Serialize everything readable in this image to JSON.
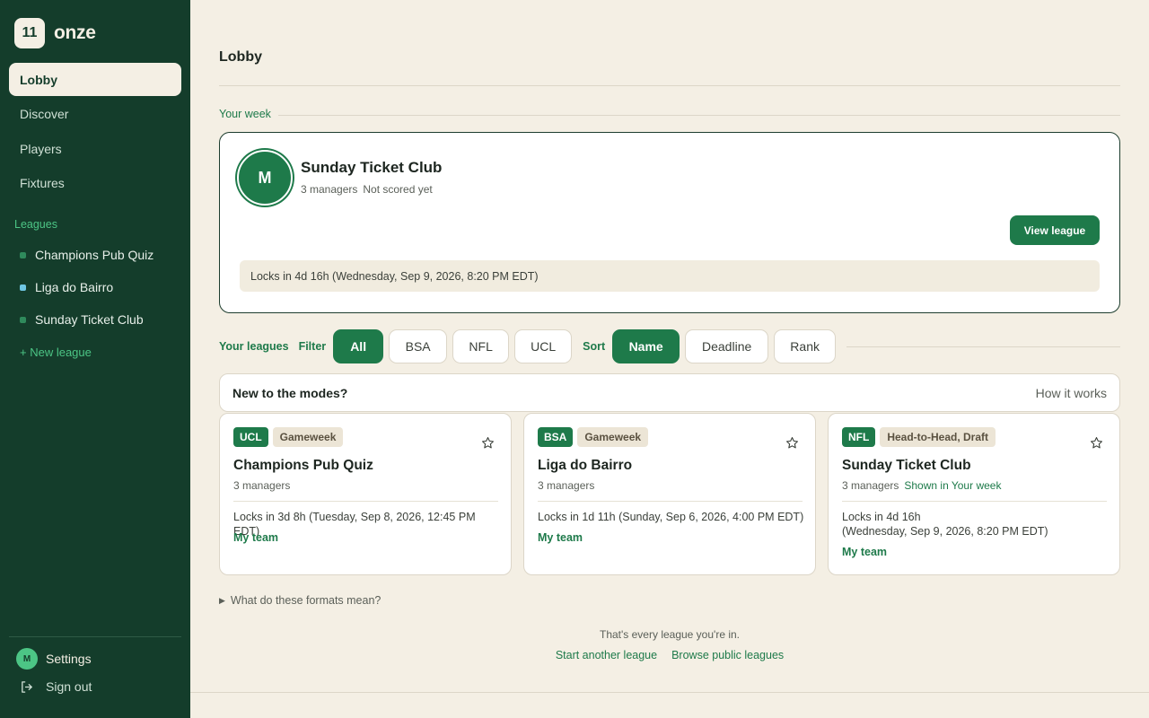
{
  "brand": {
    "mark": "11",
    "name": "onze"
  },
  "nav": [
    {
      "label": "Lobby",
      "active": true
    },
    {
      "label": "Discover"
    },
    {
      "label": "Players"
    },
    {
      "label": "Fixtures"
    }
  ],
  "sidebar": {
    "leagues_heading": "Leagues",
    "leagues": [
      {
        "name": "Champions Pub Quiz",
        "dot_color": "#2f8a5c"
      },
      {
        "name": "Liga do Bairro",
        "dot_color": "#6fc7e3"
      },
      {
        "name": "Sunday Ticket Club",
        "dot_color": "#2f8a5c"
      }
    ],
    "new_league": "+ New league",
    "settings_label": "Settings",
    "avatar_initial": "M",
    "sign_out": "Sign out"
  },
  "page": {
    "title": "Lobby"
  },
  "your_week": {
    "label": "Your week",
    "avatar_initial": "M",
    "league_name": "Sunday Ticket Club",
    "managers": "3 managers",
    "score_status": "Not scored yet",
    "view_button": "View league",
    "lock_text": "Locks in 4d 16h (Wednesday, Sep 9, 2026, 8:20 PM EDT)"
  },
  "filters": {
    "your_leagues_label": "Your leagues",
    "filter_label": "Filter",
    "filter_options": [
      "All",
      "BSA",
      "NFL",
      "UCL"
    ],
    "filter_selected": "All",
    "sort_label": "Sort",
    "sort_options": [
      "Name",
      "Deadline",
      "Rank"
    ],
    "sort_selected": "Name"
  },
  "help": {
    "title": "New to the modes?",
    "link": "How it works"
  },
  "league_cards": [
    {
      "competition": "UCL",
      "mode": "Gameweek",
      "name": "Champions Pub Quiz",
      "managers": "3 managers",
      "note": "",
      "lock_text": "Locks in 3d 8h (Tuesday, Sep 8, 2026, 12:45 PM EDT)",
      "my_team": "My team"
    },
    {
      "competition": "BSA",
      "mode": "Gameweek",
      "name": "Liga do Bairro",
      "managers": "3 managers",
      "note": "",
      "lock_text": "Locks in 1d 11h (Sunday, Sep 6, 2026, 4:00 PM EDT)",
      "my_team": "My team"
    },
    {
      "competition": "NFL",
      "mode": "Head-to-Head, Draft",
      "name": "Sunday Ticket Club",
      "managers": "3 managers",
      "note": "Shown in Your week",
      "lock_text_line1": "Locks in 4d 16h",
      "lock_text_line2": "(Wednesday, Sep 9, 2026, 8:20 PM EDT)",
      "my_team": "My team"
    }
  ],
  "footer": {
    "formats_toggle": "What do these formats mean?",
    "end_note": "That's every league you're in.",
    "start_another": "Start another league",
    "browse_public": "Browse public leagues"
  }
}
